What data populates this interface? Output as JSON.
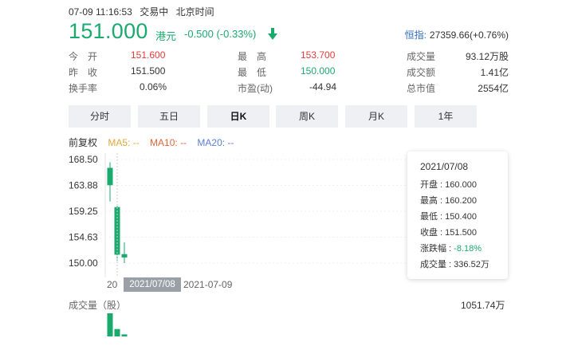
{
  "header": {
    "datetime": "07-09 11:16:53",
    "trade_status": "交易中",
    "timezone": "北京时间",
    "price": "151.000",
    "currency": "港元",
    "change": "-0.500 (-0.33%)",
    "index_name": "恒指:",
    "index_value": "27359.66(+0.76%)"
  },
  "stats": {
    "open_label": "今　开",
    "open_value": "151.600",
    "high_label": "最　高",
    "high_value": "153.700",
    "volume_label": "成交量",
    "volume_value": "93.12万股",
    "prev_label": "昨　收",
    "prev_value": "151.500",
    "low_label": "最　低",
    "low_value": "150.000",
    "turnover_label": "成交额",
    "turnover_value": "1.41亿",
    "rate_label": "换手率",
    "rate_value": "0.06%",
    "pe_label": "市盈(动)",
    "pe_value": "-44.94",
    "cap_label": "总市值",
    "cap_value": "2554亿"
  },
  "tabs": [
    "分时",
    "五日",
    "日K",
    "周K",
    "月K",
    "1年"
  ],
  "active_tab": 2,
  "ma": {
    "adjust": "前复权",
    "ma5": "MA5: --",
    "ma10": "MA10: --",
    "ma20": "MA20: --"
  },
  "colors": {
    "green": "#1aaa6e",
    "red": "#e23a3a",
    "blue": "#2b6cb8",
    "ma5": "#e0a83a",
    "ma10": "#e0653a",
    "ma20": "#5a7fd6"
  },
  "chart_data": {
    "type": "candlestick",
    "y_ticks": [
      "168.50",
      "163.88",
      "159.25",
      "154.63",
      "150.00"
    ],
    "ylim": [
      150.0,
      168.5
    ],
    "candles": [
      {
        "date": "2021/07/07",
        "open": 167.0,
        "high": 168.0,
        "low": 161.0,
        "close": 163.9
      },
      {
        "date": "2021/07/08",
        "open": 160.0,
        "high": 160.2,
        "low": 150.4,
        "close": 151.5
      },
      {
        "date": "2021/07/09",
        "open": 151.6,
        "high": 153.7,
        "low": 150.0,
        "close": 151.0
      }
    ],
    "volumes": [
      1051.74,
      336.52,
      93.12
    ],
    "volume_label": "成交量（股）",
    "volume_max_label": "1051.74万",
    "x_label_left": "20",
    "x_highlight": "2021/07/08",
    "x_label_right": "2021-07-09"
  },
  "tooltip": {
    "date": "2021/07/08",
    "open": "开盘 : 160.000",
    "high": "最高 : 160.200",
    "low": "最低 : 150.400",
    "close": "收盘 : 151.500",
    "chg_label": "涨跌幅 : ",
    "chg_value": "-8.18%",
    "vol": "成交量 : 336.52万"
  }
}
